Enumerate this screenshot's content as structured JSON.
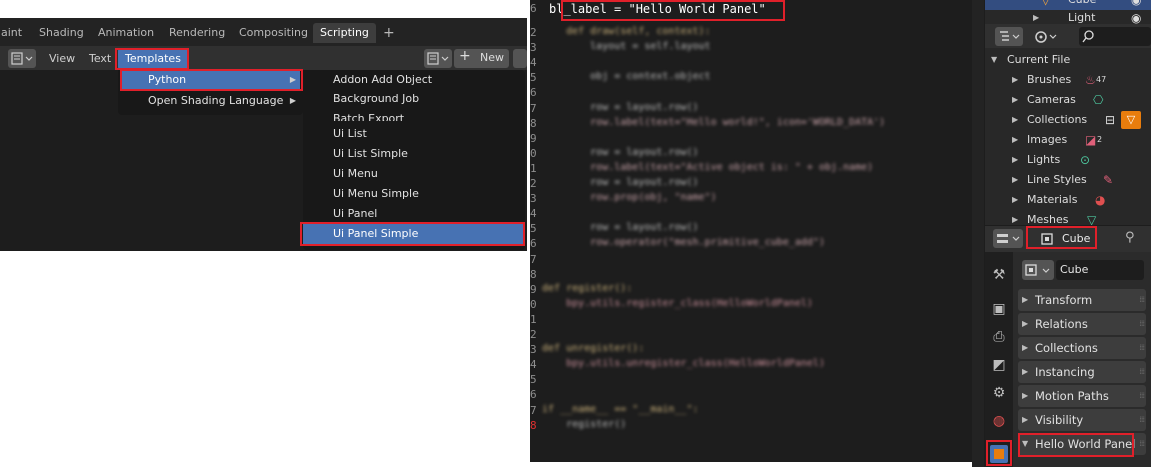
{
  "workspace_tabs": [
    "aint",
    "Shading",
    "Animation",
    "Rendering",
    "Compositing",
    "Scripting",
    "+"
  ],
  "workspace_active": "Scripting",
  "text_header": {
    "view": "View",
    "text": "Text",
    "templates": "Templates",
    "new": "New",
    "plus": "+"
  },
  "templates_menu": {
    "python": "Python",
    "osl": "Open Shading Language"
  },
  "python_submenu": [
    "Addon Add Object",
    "Background Job",
    "Batch Export",
    "Ui List",
    "Ui List Simple",
    "Ui Menu",
    "Ui Menu Simple",
    "Ui Panel",
    "Ui Panel Simple"
  ],
  "code": {
    "bl_label_line": "bl_label = \"Hello World Panel\"",
    "line_numbers": [
      "6",
      "2",
      "3",
      "4",
      "5",
      "6",
      "7",
      "8",
      "9",
      "0",
      "1",
      "2",
      "3",
      "4",
      "5",
      "6",
      "7",
      "8",
      "9",
      "0",
      "1",
      "2",
      "3",
      "4",
      "5",
      "6",
      "7",
      "8",
      "9"
    ],
    "lines": [
      "    def draw(self, context):",
      "        layout = self.layout",
      "",
      "        obj = context.object",
      "",
      "        row = layout.row()",
      "        row.label(text=\"Hello world!\", icon='WORLD_DATA')",
      "",
      "        row = layout.row()",
      "        row.label(text=\"Active object is: \" + obj.name)",
      "        row = layout.row()",
      "        row.prop(obj, \"name\")",
      "",
      "        row = layout.row()",
      "        row.operator(\"mesh.primitive_cube_add\")",
      "",
      "",
      "def register():",
      "    bpy.utils.register_class(HelloWorldPanel)",
      "",
      "",
      "def unregister():",
      "    bpy.utils.unregister_class(HelloWorldPanel)",
      "",
      "",
      "if __name__ == \"__main__\":",
      "    register()"
    ]
  },
  "outliner": {
    "top_items": [
      "Cube",
      "Light"
    ],
    "current_file": "Current File",
    "items": [
      "Brushes",
      "Cameras",
      "Collections",
      "Images",
      "Lights",
      "Line Styles",
      "Materials",
      "Meshes"
    ],
    "brushes_count": "47",
    "images_count": "2"
  },
  "properties": {
    "object_name": "Cube",
    "name_field": "Cube",
    "panels": [
      "Transform",
      "Relations",
      "Collections",
      "Instancing",
      "Motion Paths",
      "Visibility",
      "Hello World Panel"
    ]
  },
  "colors": {
    "accent_blue": "#4772b3",
    "highlight_red": "#e0202a",
    "orange": "#e87d0d"
  }
}
